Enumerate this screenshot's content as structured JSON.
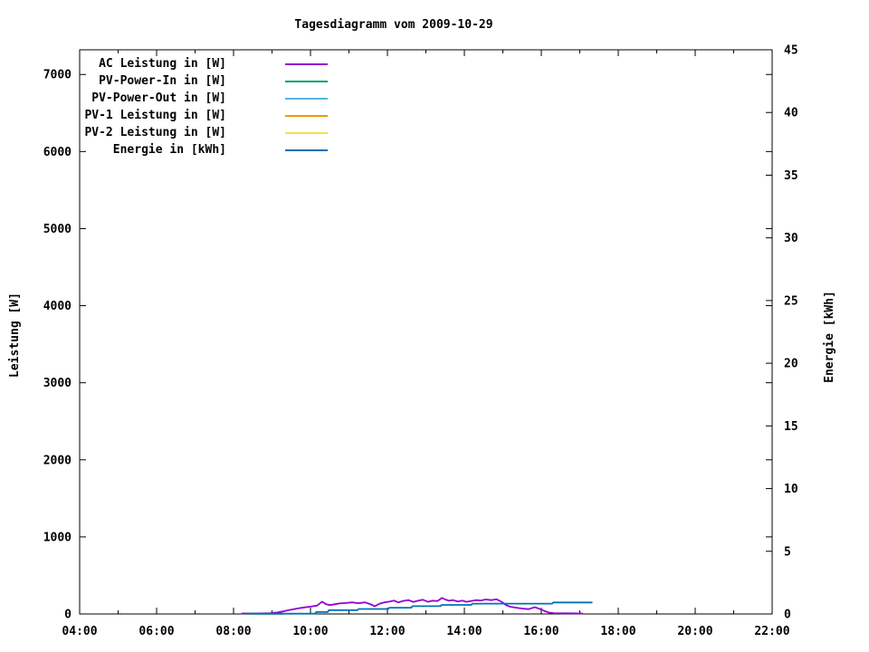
{
  "title": "Tagesdiagramm vom 2009-10-29",
  "y1_axis": {
    "label": "Leistung [W]",
    "tick_labels": [
      "0",
      "1000",
      "2000",
      "3000",
      "4000",
      "5000",
      "6000",
      "7000"
    ],
    "tick_values": [
      0,
      1000,
      2000,
      3000,
      4000,
      5000,
      6000,
      7000
    ],
    "min": 0,
    "max": 7320
  },
  "y2_axis": {
    "label": "Energie [kWh]",
    "tick_labels": [
      "0",
      "5",
      "10",
      "15",
      "20",
      "25",
      "30",
      "35",
      "40",
      "45"
    ],
    "tick_values": [
      0,
      5,
      10,
      15,
      20,
      25,
      30,
      35,
      40,
      45
    ],
    "min": 0,
    "max": 45
  },
  "x_axis": {
    "tick_labels": [
      "04:00",
      "06:00",
      "08:00",
      "10:00",
      "12:00",
      "14:00",
      "16:00",
      "18:00",
      "20:00",
      "22:00"
    ],
    "tick_hours": [
      4,
      6,
      8,
      10,
      12,
      14,
      16,
      18,
      20,
      22
    ],
    "minor_tick_hours": [
      5,
      7,
      9,
      11,
      13,
      15,
      17,
      19,
      21
    ],
    "min": 4,
    "max": 22
  },
  "legend": {
    "position": "top-left-inside",
    "items": [
      {
        "label": "AC Leistung in [W]",
        "color": "#9400d3"
      },
      {
        "label": "PV-Power-In in [W]",
        "color": "#009e73"
      },
      {
        "label": "PV-Power-Out in [W]",
        "color": "#56b4e9"
      },
      {
        "label": "PV-1 Leistung in [W]",
        "color": "#e69f00"
      },
      {
        "label": "PV-2 Leistung in [W]",
        "color": "#f0e442"
      },
      {
        "label": "Energie in [kWh]",
        "color": "#0072b2"
      }
    ]
  },
  "chart_data": {
    "type": "line",
    "title": "Tagesdiagramm vom 2009-10-29",
    "xlabel": "",
    "ylabel": "Leistung [W]",
    "y2label": "Energie [kWh]",
    "xlim_hours": [
      4,
      22
    ],
    "ylim": [
      0,
      7320
    ],
    "y2lim": [
      0,
      45
    ],
    "grid": false,
    "series": [
      {
        "name": "PV-2 Leistung in [W]",
        "color": "#f0e442",
        "axis": "y1",
        "points": [
          [
            8.25,
            2
          ],
          [
            9.3,
            2
          ]
        ]
      },
      {
        "name": "PV-1 Leistung in [W]",
        "color": "#e69f00",
        "axis": "y1",
        "points": [
          [
            8.25,
            2
          ],
          [
            9.3,
            2
          ]
        ]
      },
      {
        "name": "PV-Power-Out in [W]",
        "color": "#56b4e9",
        "axis": "y1",
        "points": [
          [
            8.25,
            3
          ],
          [
            9.3,
            3
          ]
        ]
      },
      {
        "name": "PV-Power-In in [W]",
        "color": "#009e73",
        "axis": "y1",
        "points": [
          [
            8.25,
            5
          ],
          [
            9.3,
            6
          ]
        ]
      },
      {
        "name": "AC Leistung in [W]",
        "color": "#9400d3",
        "axis": "y1",
        "points": [
          [
            8.2,
            6
          ],
          [
            8.6,
            6
          ],
          [
            8.95,
            10
          ],
          [
            9.15,
            20
          ],
          [
            9.33,
            38
          ],
          [
            9.5,
            55
          ],
          [
            9.67,
            72
          ],
          [
            9.83,
            85
          ],
          [
            10.0,
            95
          ],
          [
            10.17,
            108
          ],
          [
            10.3,
            160
          ],
          [
            10.4,
            128
          ],
          [
            10.5,
            115
          ],
          [
            10.63,
            126
          ],
          [
            10.75,
            136
          ],
          [
            10.92,
            142
          ],
          [
            11.08,
            150
          ],
          [
            11.25,
            140
          ],
          [
            11.42,
            150
          ],
          [
            11.55,
            128
          ],
          [
            11.67,
            100
          ],
          [
            11.8,
            134
          ],
          [
            11.92,
            150
          ],
          [
            12.05,
            160
          ],
          [
            12.17,
            174
          ],
          [
            12.28,
            150
          ],
          [
            12.42,
            170
          ],
          [
            12.55,
            180
          ],
          [
            12.67,
            156
          ],
          [
            12.8,
            172
          ],
          [
            12.92,
            184
          ],
          [
            13.05,
            158
          ],
          [
            13.17,
            172
          ],
          [
            13.3,
            168
          ],
          [
            13.42,
            208
          ],
          [
            13.5,
            188
          ],
          [
            13.6,
            172
          ],
          [
            13.7,
            180
          ],
          [
            13.83,
            162
          ],
          [
            13.95,
            174
          ],
          [
            14.05,
            158
          ],
          [
            14.17,
            168
          ],
          [
            14.3,
            180
          ],
          [
            14.42,
            174
          ],
          [
            14.55,
            188
          ],
          [
            14.7,
            180
          ],
          [
            14.83,
            192
          ],
          [
            14.92,
            170
          ],
          [
            15.0,
            148
          ],
          [
            15.08,
            115
          ],
          [
            15.17,
            98
          ],
          [
            15.33,
            82
          ],
          [
            15.5,
            70
          ],
          [
            15.67,
            62
          ],
          [
            15.83,
            88
          ],
          [
            15.95,
            66
          ],
          [
            16.08,
            40
          ],
          [
            16.2,
            18
          ],
          [
            16.33,
            10
          ],
          [
            16.7,
            8
          ],
          [
            17.08,
            6
          ]
        ]
      },
      {
        "name": "Energie in [kWh]",
        "color": "#0072b2",
        "axis": "y2",
        "points": [
          [
            8.3,
            0.02
          ],
          [
            10.12,
            0.02
          ],
          [
            10.15,
            0.16
          ],
          [
            10.45,
            0.16
          ],
          [
            10.48,
            0.3
          ],
          [
            11.22,
            0.3
          ],
          [
            11.25,
            0.4
          ],
          [
            12.02,
            0.4
          ],
          [
            12.05,
            0.5
          ],
          [
            12.62,
            0.5
          ],
          [
            12.65,
            0.62
          ],
          [
            13.38,
            0.62
          ],
          [
            13.41,
            0.72
          ],
          [
            14.18,
            0.72
          ],
          [
            14.21,
            0.82
          ],
          [
            16.28,
            0.82
          ],
          [
            16.31,
            0.92
          ],
          [
            17.33,
            0.92
          ]
        ]
      }
    ]
  }
}
